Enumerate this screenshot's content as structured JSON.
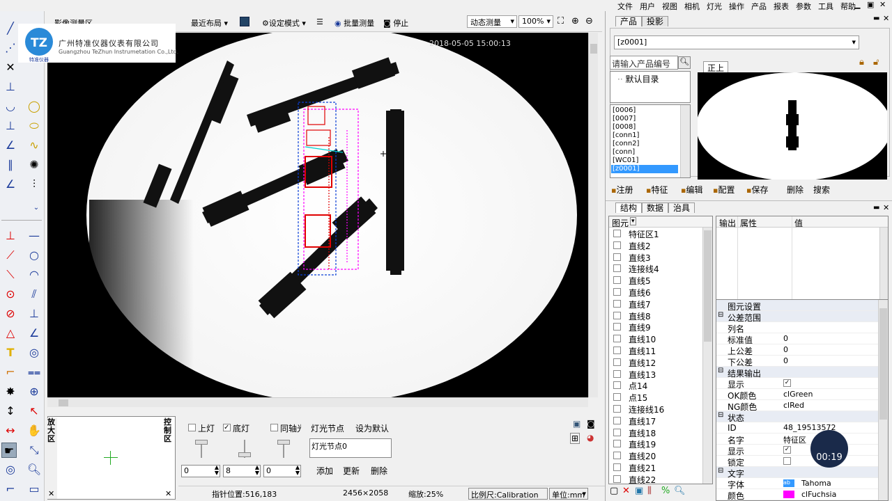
{
  "menu": [
    "文件",
    "用户",
    "视图",
    "相机",
    "灯光",
    "操作",
    "产品",
    "报表",
    "参数",
    "工具",
    "帮助"
  ],
  "toolbar": {
    "image_label": "影像测量区",
    "layout_label": "最近布局",
    "design_mode_label": "设定模式",
    "batch_measure_label": "批量测量",
    "stop_label": "停止",
    "mode_value": "动态测量",
    "zoom_value": "100%"
  },
  "logo": {
    "badge_text": "TZ",
    "company_cn": "广州特准仪器仪表有限公司",
    "company_en": "Guangzhou TeZhun Instrumetation Co.,Ltd.",
    "badge_sub": "特准仪器"
  },
  "image": {
    "timestamp": "2018-05-05 15:00:13"
  },
  "zoom_panel": {
    "label": "放大区"
  },
  "control_panel": {
    "label": "控制区",
    "top_light": "上灯",
    "bottom_light": "底灯",
    "coaxial": "同轴光",
    "light_node_label": "灯光节点",
    "set_default": "设为默认",
    "node_value": "灯光节点0",
    "spin1": "0",
    "spin2": "8",
    "spin3": "0",
    "add": "添加",
    "update": "更新",
    "delete": "删除"
  },
  "status": {
    "pointer": "指针位置:516,183",
    "resolution": "2456×2058",
    "zoom": "缩放:25%",
    "scale": "比例尺:Calibration",
    "unit": "单位:mm"
  },
  "product_panel": {
    "tab1": "产品",
    "tab2": "投影",
    "product_select": "[z0001]",
    "search_placeholder": "请输入产品编号",
    "default_dir": "默认目录",
    "list": [
      "[0006]",
      "[0007]",
      "[0008]",
      "[conn1]",
      "[conn2]",
      "[conn]",
      "[WC01]",
      "[z0001]"
    ],
    "selected": "[z0001]",
    "view_tab": "正上",
    "actions": [
      "注册",
      "特征",
      "编辑",
      "配置",
      "保存",
      "删除",
      "搜索"
    ]
  },
  "structure_panel": {
    "tabs": [
      "结构",
      "数据",
      "治具"
    ],
    "tree_header": "图元",
    "items": [
      "特征区1",
      "直线2",
      "直线3",
      "连接线4",
      "直线5",
      "直线6",
      "直线7",
      "直线8",
      "直线9",
      "直线10",
      "直线11",
      "直线12",
      "直线13",
      "点14",
      "点15",
      "连接线16",
      "直线17",
      "直线18",
      "直线19",
      "直线20",
      "直线21",
      "直线22"
    ],
    "grid_headers": [
      "输出",
      "属性",
      "值"
    ]
  },
  "props": {
    "rows": [
      {
        "k": "图元设置",
        "v": "",
        "type": "cat0"
      },
      {
        "k": "公差范围",
        "v": "",
        "type": "cat"
      },
      {
        "k": "列名",
        "v": "",
        "type": "row"
      },
      {
        "k": "标准值",
        "v": "0",
        "type": "row"
      },
      {
        "k": "上公差",
        "v": "0",
        "type": "row"
      },
      {
        "k": "下公差",
        "v": "0",
        "type": "row"
      },
      {
        "k": "结果输出",
        "v": "",
        "type": "cat"
      },
      {
        "k": "显示",
        "v": "✓",
        "type": "chk"
      },
      {
        "k": "OK颜色",
        "v": "clGreen",
        "type": "row"
      },
      {
        "k": "NG颜色",
        "v": "clRed",
        "type": "row"
      },
      {
        "k": "状态",
        "v": "",
        "type": "cat"
      },
      {
        "k": "ID",
        "v": "48_19513572",
        "type": "row"
      },
      {
        "k": "名字",
        "v": "特征区",
        "type": "row"
      },
      {
        "k": "显示",
        "v": "✓",
        "type": "chk"
      },
      {
        "k": "锁定",
        "v": "",
        "type": "chk"
      },
      {
        "k": "文字",
        "v": "",
        "type": "cat"
      },
      {
        "k": "字体",
        "v": "Tahoma",
        "type": "font"
      },
      {
        "k": "颜色",
        "v": "clFuchsia",
        "type": "color"
      }
    ]
  },
  "timer": "00:19",
  "colors": {
    "accent": "#0a3fd6",
    "select": "#3399ff",
    "red": "#e00000",
    "fuchsia": "#ff00ff",
    "timer_bg": "#1a2a4a"
  }
}
